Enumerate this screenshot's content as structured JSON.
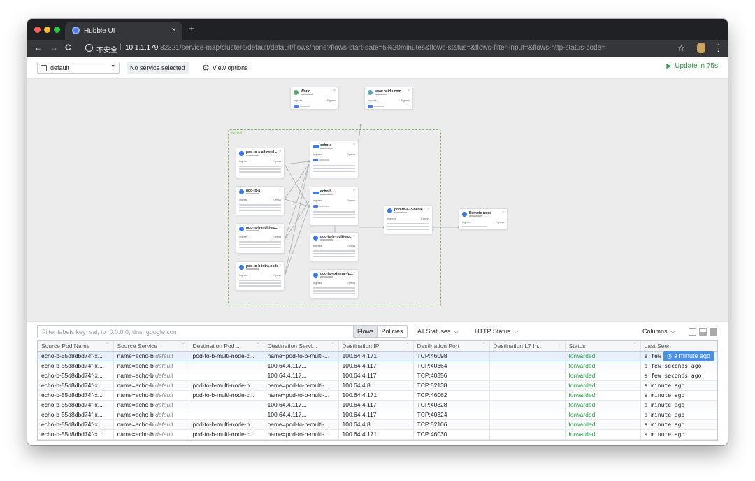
{
  "browser": {
    "tab_title": "Hubble UI",
    "tab_close": "×",
    "new_tab": "+",
    "nav_back": "←",
    "nav_forward": "→",
    "nav_reload": "C",
    "info_icon": "!",
    "not_secure": "不安全",
    "url_sep": "|",
    "url_host": "10.1.1.179",
    "url_path": ":32321/service-map/clusters/default/default/flows/none?flows-start-date=5%20minutes&flows-status=&flows-filter-input=&flows-http-status-code=",
    "star": "☆",
    "menu": "⋮"
  },
  "appbar": {
    "namespace": "default",
    "service_selected": "No service selected",
    "view_options": "View options",
    "update": "Update in 75s"
  },
  "map": {
    "namespace_label": "default",
    "cards": [
      {
        "name": "World",
        "ingress": "Ingress",
        "egress": "Egress"
      },
      {
        "name": "www.baidu.com",
        "ingress": "Ingress",
        "egress": "Egress"
      },
      {
        "name": "echo-a",
        "ingress": "Ingress",
        "egress": "Egress"
      },
      {
        "name": "echo-b",
        "ingress": "Ingress",
        "egress": "Egress"
      },
      {
        "name": "pod-to-a-allowed-...",
        "ingress": "Ingress",
        "egress": "Egress"
      },
      {
        "name": "pod-to-a",
        "ingress": "Ingress",
        "egress": "Egress"
      },
      {
        "name": "pod-to-b-multi-no...",
        "ingress": "Ingress",
        "egress": "Egress"
      },
      {
        "name": "pod-to-b-intra-node",
        "ingress": "Ingress",
        "egress": "Egress"
      },
      {
        "name": "pod-to-b-multi-no...",
        "ingress": "Ingress",
        "egress": "Egress"
      },
      {
        "name": "pod-to-external-fq...",
        "ingress": "Ingress",
        "egress": "Egress"
      },
      {
        "name": "pod-to-a-l3-denie...",
        "ingress": "Ingress",
        "egress": "Egress"
      },
      {
        "name": "Remote-node",
        "ingress": "Ingress",
        "egress": "Egress"
      }
    ]
  },
  "filterbar": {
    "placeholder": "Filter labels key=val, ip=0.0.0.0, dns=google.com",
    "flows": "Flows",
    "policies": "Policies",
    "all_statuses": "All Statuses",
    "http_status": "HTTP Status",
    "columns": "Columns"
  },
  "table": {
    "columns": [
      "Source Pod Name",
      "Source Service",
      "Destination Pod ...",
      "Destination Servi...",
      "Destination IP",
      "Destination Port",
      "Destination L7 In...",
      "Status",
      "Last Seen"
    ],
    "rows": [
      {
        "src_pod": "echo-b-55d8dbd74f-x...",
        "src_svc": "name=echo-b",
        "src_ns": "default",
        "dst_pod": "pod-to-b-multi-node-c...",
        "dst_svc": "name=pod-to-b-multi-...",
        "dst_ip": "100.64.4.171",
        "dst_port": "TCP:46098",
        "l7": "",
        "status": "forwarded",
        "last_seen": "a few seconds ago"
      },
      {
        "src_pod": "echo-b-55d8dbd74f-x...",
        "src_svc": "name=echo-b",
        "src_ns": "default",
        "dst_pod": "",
        "dst_svc": "100.64.4.117...",
        "dst_ip": "100.64.4.117",
        "dst_port": "TCP:40364",
        "l7": "",
        "status": "forwarded",
        "last_seen": "a few seconds ago"
      },
      {
        "src_pod": "echo-b-55d8dbd74f-x...",
        "src_svc": "name=echo-b",
        "src_ns": "default",
        "dst_pod": "",
        "dst_svc": "100.64.4.117...",
        "dst_ip": "100.64.4.117",
        "dst_port": "TCP:40356",
        "l7": "",
        "status": "forwarded",
        "last_seen": "a few seconds ago"
      },
      {
        "src_pod": "echo-b-55d8dbd74f-x...",
        "src_svc": "name=echo-b",
        "src_ns": "default",
        "dst_pod": "pod-to-b-multi-node-h...",
        "dst_svc": "name=pod-to-b-multi-...",
        "dst_ip": "100.64.4.8",
        "dst_port": "TCP:52138",
        "l7": "",
        "status": "forwarded",
        "last_seen": "a minute ago"
      },
      {
        "src_pod": "echo-b-55d8dbd74f-x...",
        "src_svc": "name=echo-b",
        "src_ns": "default",
        "dst_pod": "pod-to-b-multi-node-c...",
        "dst_svc": "name=pod-to-b-multi-...",
        "dst_ip": "100.64.4.171",
        "dst_port": "TCP:46062",
        "l7": "",
        "status": "forwarded",
        "last_seen": "a minute ago"
      },
      {
        "src_pod": "echo-b-55d8dbd74f-x...",
        "src_svc": "name=echo-b",
        "src_ns": "default",
        "dst_pod": "",
        "dst_svc": "100.64.4.117...",
        "dst_ip": "100.64.4.117",
        "dst_port": "TCP:40328",
        "l7": "",
        "status": "forwarded",
        "last_seen": "a minute ago"
      },
      {
        "src_pod": "echo-b-55d8dbd74f-x...",
        "src_svc": "name=echo-b",
        "src_ns": "default",
        "dst_pod": "",
        "dst_svc": "100.64.4.117...",
        "dst_ip": "100.64.4.117",
        "dst_port": "TCP:40324",
        "l7": "",
        "status": "forwarded",
        "last_seen": "a minute ago"
      },
      {
        "src_pod": "echo-b-55d8dbd74f-x...",
        "src_svc": "name=echo-b",
        "src_ns": "default",
        "dst_pod": "pod-to-b-multi-node-h...",
        "dst_svc": "name=pod-to-b-multi-...",
        "dst_ip": "100.64.4.8",
        "dst_port": "TCP:52106",
        "l7": "",
        "status": "forwarded",
        "last_seen": "a minute ago"
      },
      {
        "src_pod": "echo-b-55d8dbd74f-x...",
        "src_svc": "name=echo-b",
        "src_ns": "default",
        "dst_pod": "pod-to-b-multi-node-c...",
        "dst_svc": "name=pod-to-b-multi-...",
        "dst_ip": "100.64.4.171",
        "dst_port": "TCP:46030",
        "l7": "",
        "status": "forwarded",
        "last_seen": "a minute ago"
      }
    ],
    "tooltip": "a minute ago"
  },
  "colors": {
    "accent": "#4a90e2",
    "forwarded": "#2da44e",
    "update_green": "#2d9a40",
    "namespace_border": "#7fbf5a"
  }
}
